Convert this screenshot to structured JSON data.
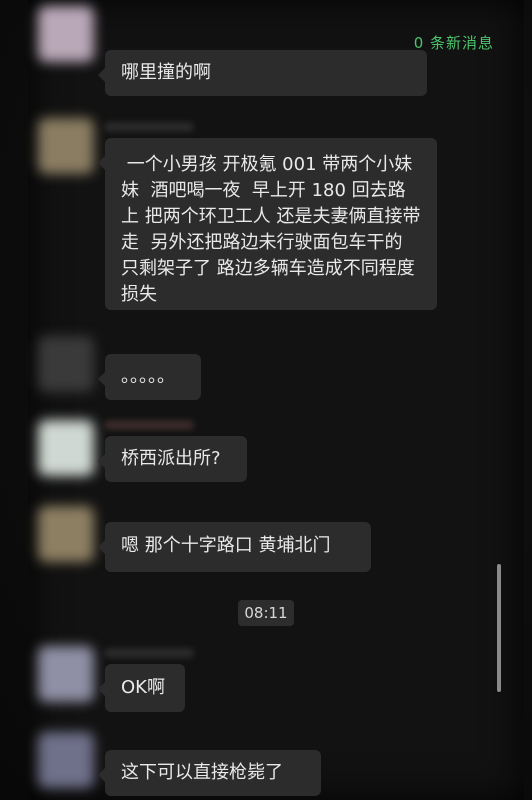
{
  "header": {
    "new_message_text": "0 条新消息",
    "new_message_color": "#4cc46a"
  },
  "messages": [
    {
      "text": "哪里撞的啊"
    },
    {
      "text": " 一个小男孩 开极氪 001 带两个小妹妹  酒吧喝一夜  早上开 180 回去路上 把两个环卫工人 还是夫妻俩直接带走  另外还把路边未行驶面包车干的 只剩架子了 路边多辆车造成不同程度损失"
    },
    {
      "text": "。。。。。"
    },
    {
      "text": "桥西派出所?"
    },
    {
      "text": "嗯 那个十字路口 黄埔北门"
    },
    {
      "text": "OK啊"
    },
    {
      "text": "这下可以直接枪毙了"
    }
  ],
  "timestamp": "08:11",
  "icons": {
    "avatar": "avatar-icon"
  }
}
